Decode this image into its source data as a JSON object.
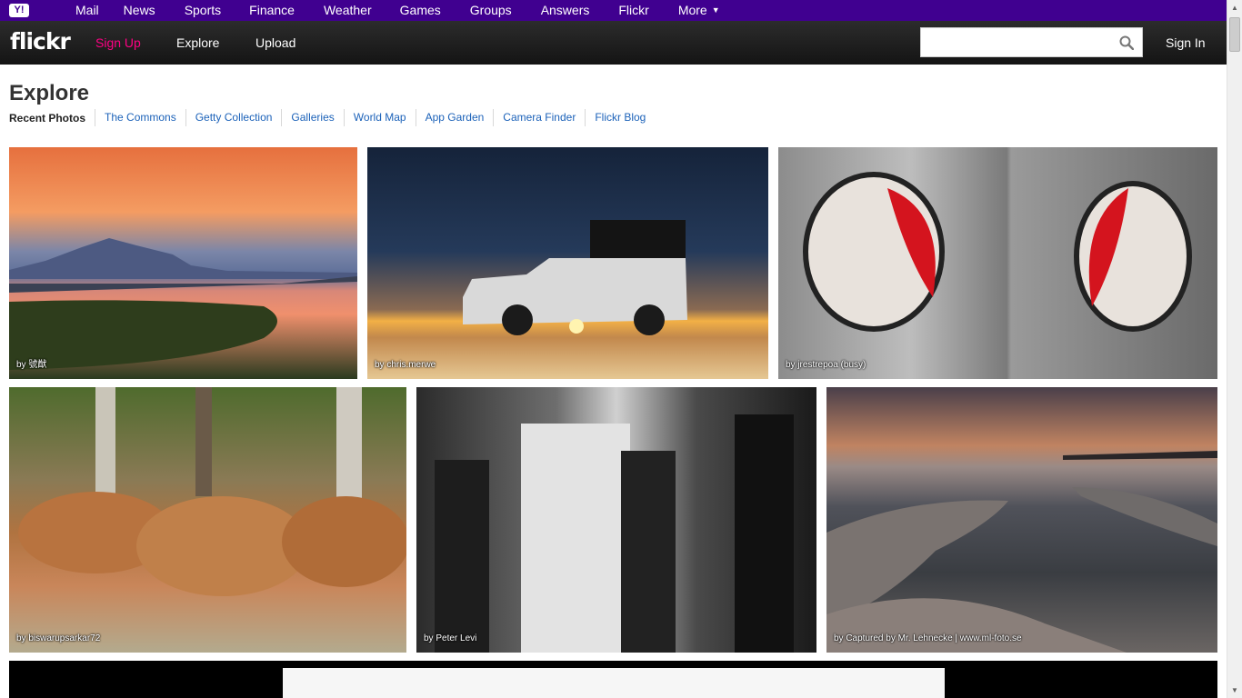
{
  "yahoo_bar": {
    "logo": "Y!",
    "links": [
      "Mail",
      "News",
      "Sports",
      "Finance",
      "Weather",
      "Games",
      "Groups",
      "Answers",
      "Flickr"
    ],
    "more": "More"
  },
  "header": {
    "logo": "flickr",
    "signup": "Sign Up",
    "explore": "Explore",
    "upload": "Upload",
    "search_value": "",
    "signin": "Sign In"
  },
  "page": {
    "title": "Explore",
    "current_tab": "Recent Photos",
    "tabs": [
      "The Commons",
      "Getty Collection",
      "Galleries",
      "World Map",
      "App Garden",
      "Camera Finder",
      "Flickr Blog"
    ]
  },
  "photos": [
    {
      "attribution": "by 號猷"
    },
    {
      "attribution": "by chris.merwe"
    },
    {
      "attribution": "by jrestrepoa (busy)"
    },
    {
      "attribution": "by biswarupsarkar72"
    },
    {
      "attribution": "by Peter Levi"
    },
    {
      "attribution": "by Captured by Mr. Lehnecke | www.ml-foto.se"
    }
  ],
  "colors": {
    "yahoo_purple": "#400090",
    "flickr_pink": "#ff0084",
    "link_blue": "#1c62b9"
  }
}
